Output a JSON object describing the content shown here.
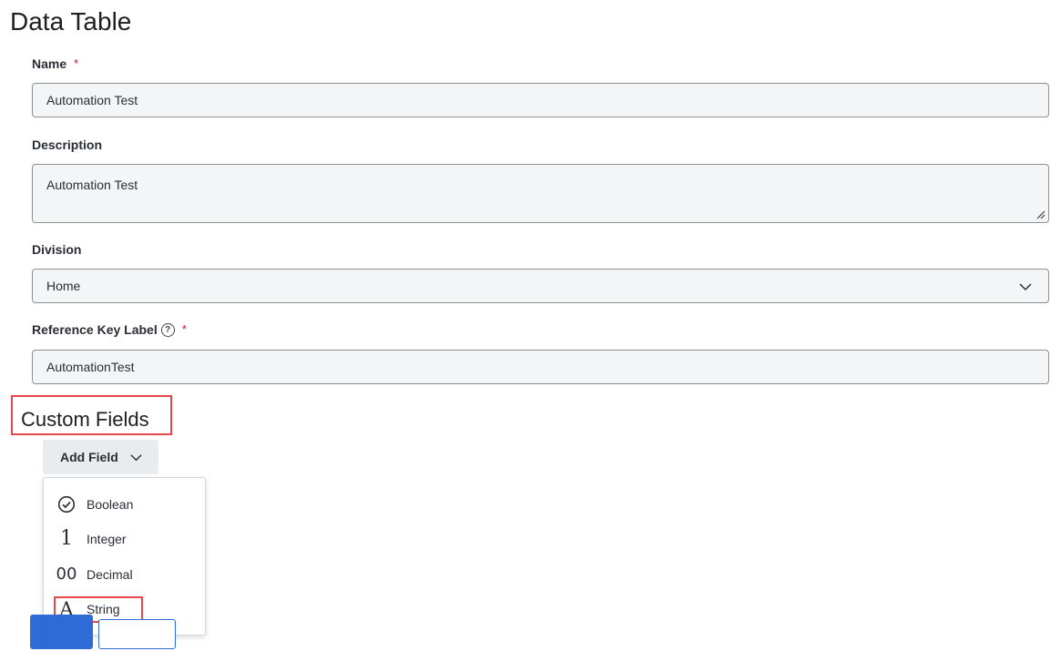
{
  "page": {
    "title": "Data Table"
  },
  "form": {
    "name": {
      "label": "Name",
      "required_mark": "*",
      "value": "Automation Test"
    },
    "description": {
      "label": "Description",
      "value": "Automation Test"
    },
    "division": {
      "label": "Division",
      "value": "Home",
      "icon": "chevron-down-icon"
    },
    "reference_key": {
      "label": "Reference Key Label",
      "help_icon": "?",
      "required_mark": "*",
      "value": "AutomationTest"
    }
  },
  "custom_fields": {
    "title": "Custom Fields",
    "add_field_label": "Add Field",
    "menu": [
      {
        "icon": "check-circle-icon",
        "glyph": "",
        "label": "Boolean"
      },
      {
        "icon": "integer-icon",
        "glyph": "1",
        "label": "Integer"
      },
      {
        "icon": "decimal-icon",
        "glyph": "00",
        "label": "Decimal"
      },
      {
        "icon": "string-icon",
        "glyph": "A",
        "label": "String"
      }
    ]
  },
  "colors": {
    "highlight": "#e8474a",
    "required": "#c8102e",
    "primary": "#2e6bd6"
  }
}
